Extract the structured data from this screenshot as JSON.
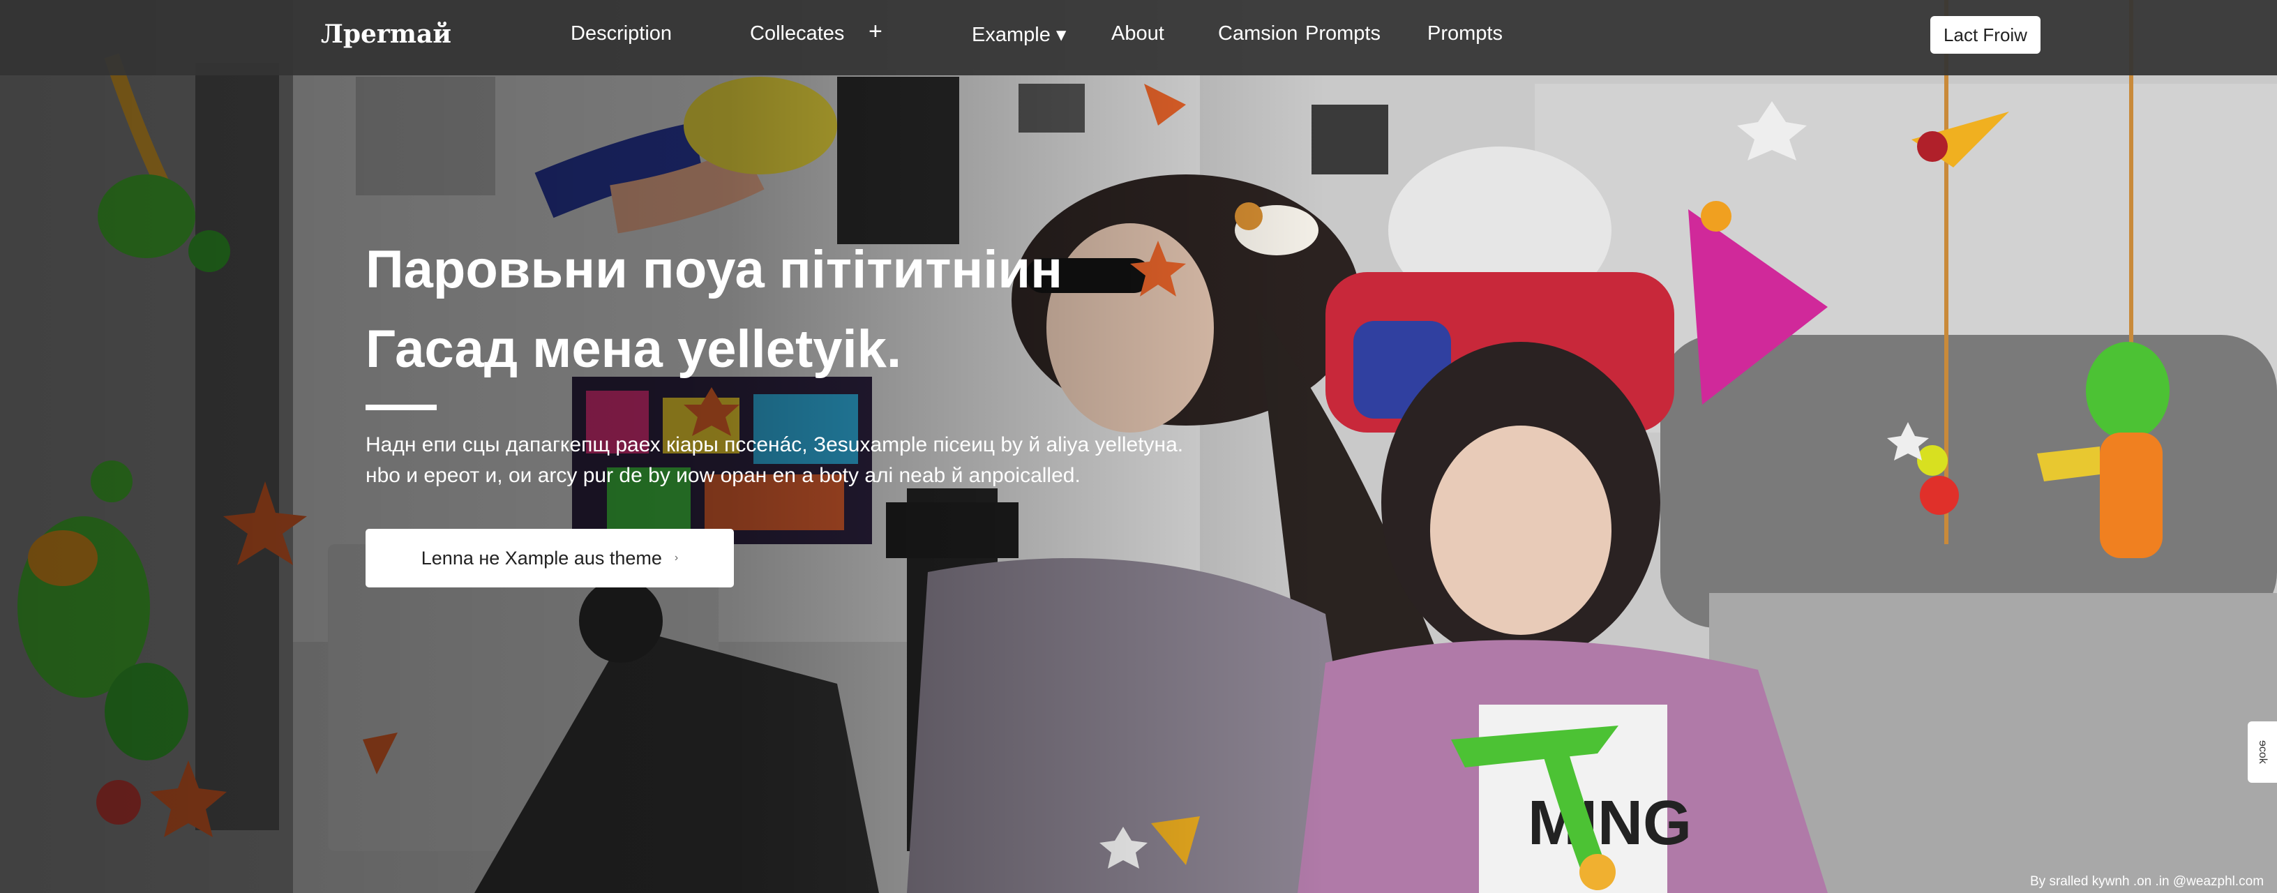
{
  "nav": {
    "logo": "Лрermaй",
    "items": [
      {
        "label": "Description"
      },
      {
        "label": "Collecates"
      },
      {
        "label": "+"
      },
      {
        "label": "Example ▾"
      },
      {
        "label": "About"
      },
      {
        "label": "Camsion"
      },
      {
        "label": "Prompts"
      },
      {
        "label": "Prompts"
      }
    ],
    "cta": "Lact Froiw"
  },
  "hero": {
    "headline_line1": "Паровьни поуа пiтiтитнiин",
    "headline_line2": "Гасад мена yelletyik.",
    "subtext_line1": "Надн епи сцы дапагкепщ раех кiары пссенác, Зesuxample пiсеиц by й aliya yelletyна.",
    "subtext_line2": "нbo и ереот и, ои arcy pur de by иow оран en a boty aлi neab й anpoicalled.",
    "cta_label": "Lenna не Xample aus theme",
    "cta_arrow": "›"
  },
  "side_tab": "ɘcok",
  "credit": "By sralled kywnh .on .in @weazphl.com",
  "colors": {
    "navbar": "#343434",
    "accent_green": "#4cc234",
    "accent_orange": "#e8642a",
    "hat_red": "#c8283a",
    "hat_pink": "#d0299a"
  }
}
